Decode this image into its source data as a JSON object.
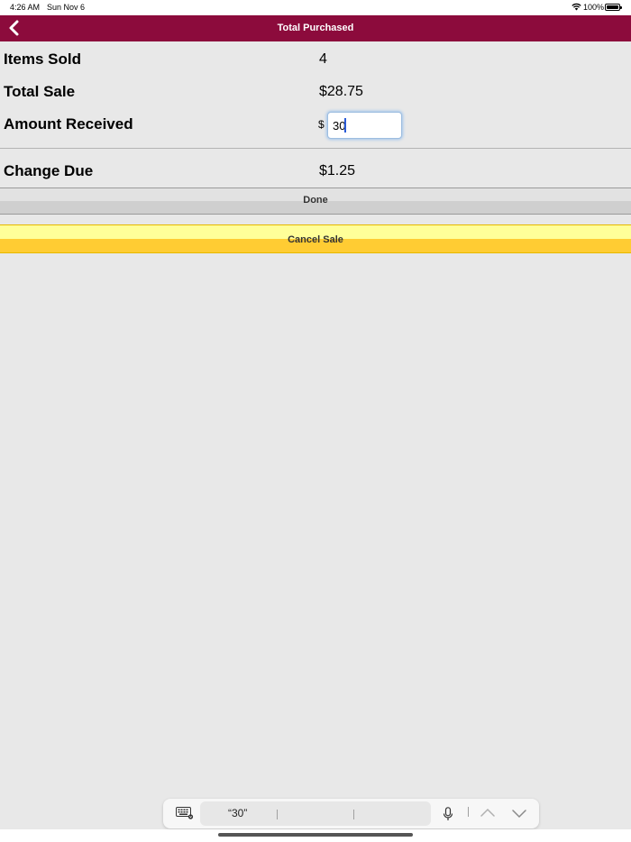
{
  "status_bar": {
    "time": "4:26 AM",
    "date": "Sun Nov 6",
    "battery": "100%",
    "wifi_icon": "wifi-icon",
    "battery_icon": "battery-icon"
  },
  "navbar": {
    "title": "Total Purchased",
    "back_icon": "chevron-left-icon",
    "background": "#8c0b3c"
  },
  "summary": {
    "items_sold_label": "Items Sold",
    "items_sold_value": "4",
    "total_sale_label": "Total Sale",
    "total_sale_value": "$28.75",
    "amount_received_label": "Amount Received",
    "amount_received_currency": "$",
    "amount_received_value": "30",
    "change_due_label": "Change Due",
    "change_due_value": "$1.25"
  },
  "buttons": {
    "done": "Done",
    "cancel_sale": "Cancel Sale",
    "cancel_color_top": "#ffff99",
    "cancel_color_bottom": "#ffcc33"
  },
  "keyboard_bar": {
    "suggestion": "“30”",
    "keyboard_icon": "keyboard-dismiss-icon",
    "mic_icon": "microphone-icon",
    "up_icon": "chevron-up-icon",
    "down_icon": "chevron-down-icon"
  }
}
